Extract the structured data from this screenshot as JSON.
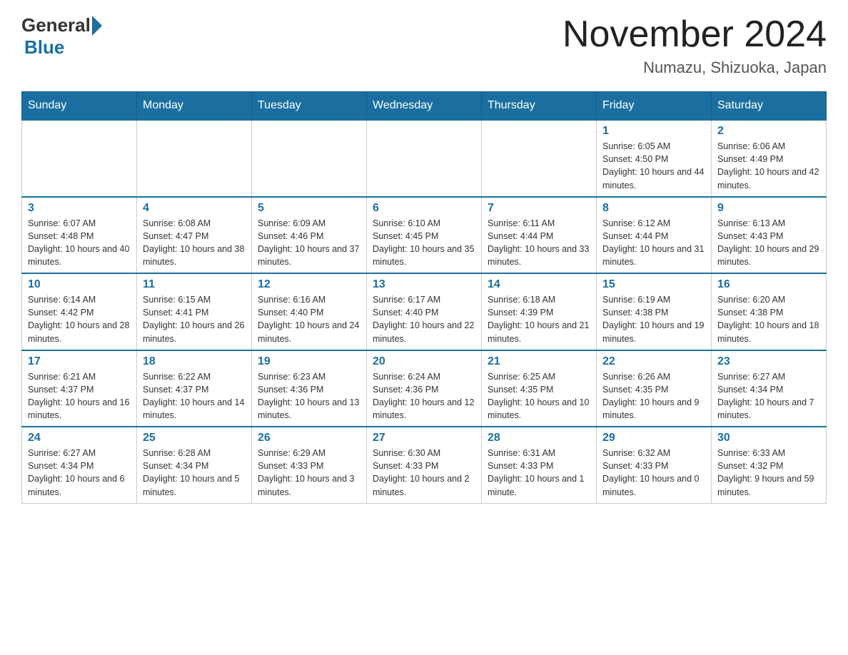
{
  "header": {
    "logo_general": "General",
    "logo_blue": "Blue",
    "month_title": "November 2024",
    "location": "Numazu, Shizuoka, Japan"
  },
  "weekdays": [
    "Sunday",
    "Monday",
    "Tuesday",
    "Wednesday",
    "Thursday",
    "Friday",
    "Saturday"
  ],
  "weeks": [
    [
      {
        "day": "",
        "info": ""
      },
      {
        "day": "",
        "info": ""
      },
      {
        "day": "",
        "info": ""
      },
      {
        "day": "",
        "info": ""
      },
      {
        "day": "",
        "info": ""
      },
      {
        "day": "1",
        "info": "Sunrise: 6:05 AM\nSunset: 4:50 PM\nDaylight: 10 hours and 44 minutes."
      },
      {
        "day": "2",
        "info": "Sunrise: 6:06 AM\nSunset: 4:49 PM\nDaylight: 10 hours and 42 minutes."
      }
    ],
    [
      {
        "day": "3",
        "info": "Sunrise: 6:07 AM\nSunset: 4:48 PM\nDaylight: 10 hours and 40 minutes."
      },
      {
        "day": "4",
        "info": "Sunrise: 6:08 AM\nSunset: 4:47 PM\nDaylight: 10 hours and 38 minutes."
      },
      {
        "day": "5",
        "info": "Sunrise: 6:09 AM\nSunset: 4:46 PM\nDaylight: 10 hours and 37 minutes."
      },
      {
        "day": "6",
        "info": "Sunrise: 6:10 AM\nSunset: 4:45 PM\nDaylight: 10 hours and 35 minutes."
      },
      {
        "day": "7",
        "info": "Sunrise: 6:11 AM\nSunset: 4:44 PM\nDaylight: 10 hours and 33 minutes."
      },
      {
        "day": "8",
        "info": "Sunrise: 6:12 AM\nSunset: 4:44 PM\nDaylight: 10 hours and 31 minutes."
      },
      {
        "day": "9",
        "info": "Sunrise: 6:13 AM\nSunset: 4:43 PM\nDaylight: 10 hours and 29 minutes."
      }
    ],
    [
      {
        "day": "10",
        "info": "Sunrise: 6:14 AM\nSunset: 4:42 PM\nDaylight: 10 hours and 28 minutes."
      },
      {
        "day": "11",
        "info": "Sunrise: 6:15 AM\nSunset: 4:41 PM\nDaylight: 10 hours and 26 minutes."
      },
      {
        "day": "12",
        "info": "Sunrise: 6:16 AM\nSunset: 4:40 PM\nDaylight: 10 hours and 24 minutes."
      },
      {
        "day": "13",
        "info": "Sunrise: 6:17 AM\nSunset: 4:40 PM\nDaylight: 10 hours and 22 minutes."
      },
      {
        "day": "14",
        "info": "Sunrise: 6:18 AM\nSunset: 4:39 PM\nDaylight: 10 hours and 21 minutes."
      },
      {
        "day": "15",
        "info": "Sunrise: 6:19 AM\nSunset: 4:38 PM\nDaylight: 10 hours and 19 minutes."
      },
      {
        "day": "16",
        "info": "Sunrise: 6:20 AM\nSunset: 4:38 PM\nDaylight: 10 hours and 18 minutes."
      }
    ],
    [
      {
        "day": "17",
        "info": "Sunrise: 6:21 AM\nSunset: 4:37 PM\nDaylight: 10 hours and 16 minutes."
      },
      {
        "day": "18",
        "info": "Sunrise: 6:22 AM\nSunset: 4:37 PM\nDaylight: 10 hours and 14 minutes."
      },
      {
        "day": "19",
        "info": "Sunrise: 6:23 AM\nSunset: 4:36 PM\nDaylight: 10 hours and 13 minutes."
      },
      {
        "day": "20",
        "info": "Sunrise: 6:24 AM\nSunset: 4:36 PM\nDaylight: 10 hours and 12 minutes."
      },
      {
        "day": "21",
        "info": "Sunrise: 6:25 AM\nSunset: 4:35 PM\nDaylight: 10 hours and 10 minutes."
      },
      {
        "day": "22",
        "info": "Sunrise: 6:26 AM\nSunset: 4:35 PM\nDaylight: 10 hours and 9 minutes."
      },
      {
        "day": "23",
        "info": "Sunrise: 6:27 AM\nSunset: 4:34 PM\nDaylight: 10 hours and 7 minutes."
      }
    ],
    [
      {
        "day": "24",
        "info": "Sunrise: 6:27 AM\nSunset: 4:34 PM\nDaylight: 10 hours and 6 minutes."
      },
      {
        "day": "25",
        "info": "Sunrise: 6:28 AM\nSunset: 4:34 PM\nDaylight: 10 hours and 5 minutes."
      },
      {
        "day": "26",
        "info": "Sunrise: 6:29 AM\nSunset: 4:33 PM\nDaylight: 10 hours and 3 minutes."
      },
      {
        "day": "27",
        "info": "Sunrise: 6:30 AM\nSunset: 4:33 PM\nDaylight: 10 hours and 2 minutes."
      },
      {
        "day": "28",
        "info": "Sunrise: 6:31 AM\nSunset: 4:33 PM\nDaylight: 10 hours and 1 minute."
      },
      {
        "day": "29",
        "info": "Sunrise: 6:32 AM\nSunset: 4:33 PM\nDaylight: 10 hours and 0 minutes."
      },
      {
        "day": "30",
        "info": "Sunrise: 6:33 AM\nSunset: 4:32 PM\nDaylight: 9 hours and 59 minutes."
      }
    ]
  ]
}
